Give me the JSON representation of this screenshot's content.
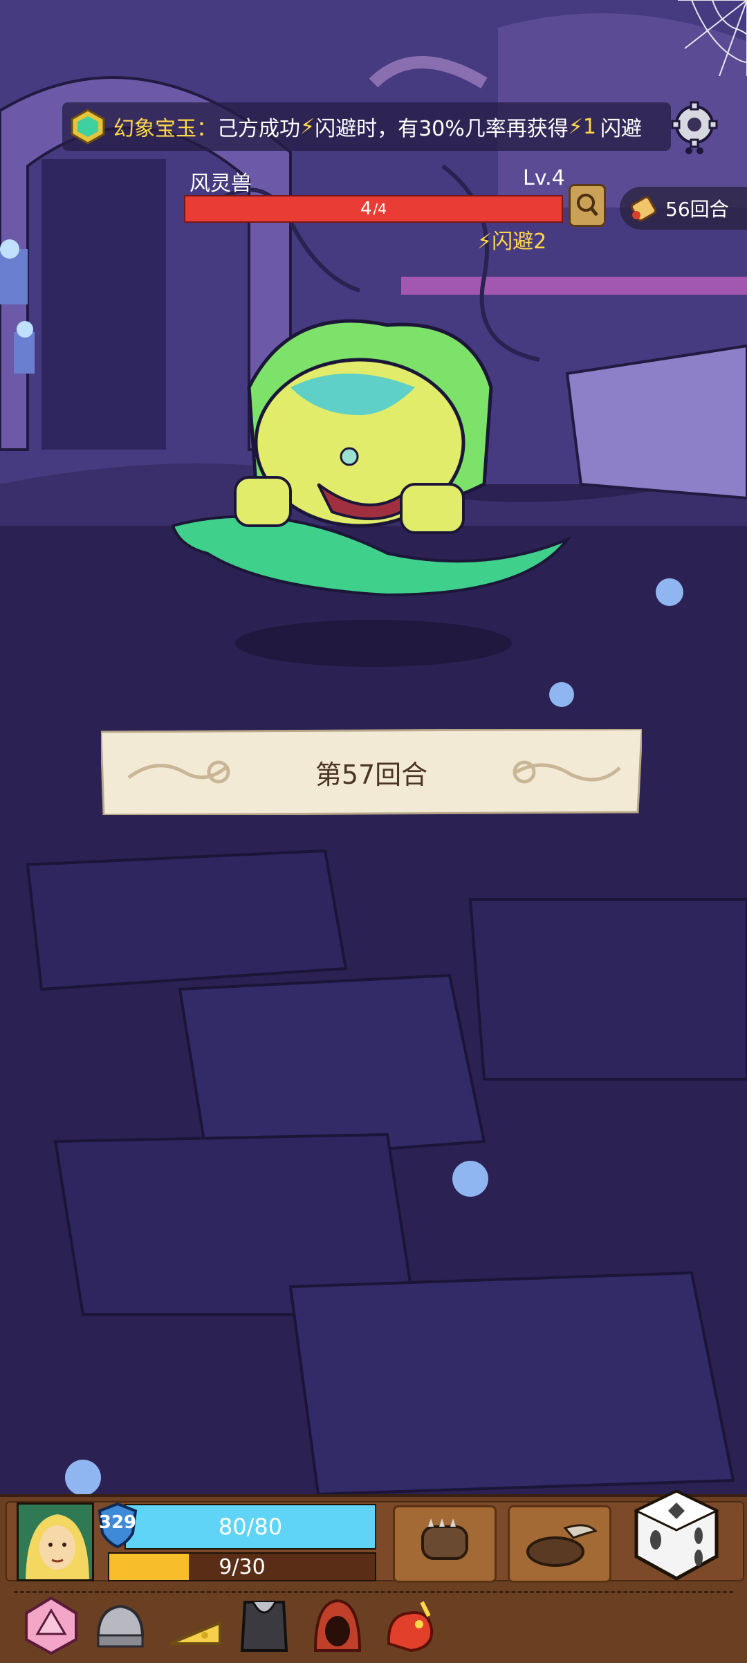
{
  "relic_banner": {
    "name": "幻象宝玉",
    "colon": "：",
    "desc_prefix": "己方成功",
    "bolt1": "⚡",
    "desc_mid": "闪避时，有30%几率再获得",
    "bolt2": "⚡",
    "bonus_amount": "1",
    "desc_suffix": "闪避"
  },
  "enemy": {
    "name": "风灵兽",
    "level": "Lv.4",
    "hp_current": "4",
    "hp_max": "/4",
    "hp_fraction": 1.0,
    "status_bolt": "⚡",
    "status_label": "闪避2"
  },
  "round_counter": {
    "label": "56回合"
  },
  "round_banner": {
    "text": "第57回合"
  },
  "player": {
    "armor_value": "329",
    "hp_text": "80/80",
    "hp_fraction": 1.0,
    "energy_text": "9/30",
    "energy_fraction": 0.3
  },
  "skills": [
    "spiked-fist-skill",
    "dig-skill"
  ],
  "inventory": [
    "d20-dice",
    "helmet-item",
    "cheese-item",
    "chest-armor-item",
    "hood-item",
    "fire-dragon-item"
  ],
  "colors": {
    "hp_red": "#e83c35",
    "hp_blue": "#5fd4f6",
    "energy_yellow": "#f7bd2b",
    "accent_yellow": "#ffd84a"
  }
}
